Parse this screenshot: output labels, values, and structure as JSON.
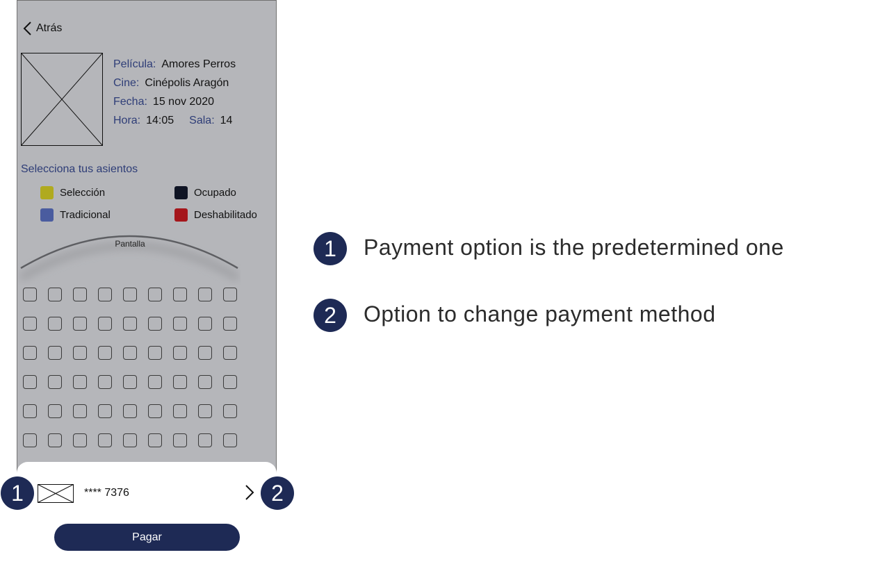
{
  "back": {
    "label": "Atrás"
  },
  "movie": {
    "pelicula_label": "Película:",
    "pelicula": "Amores Perros",
    "cine_label": "Cine:",
    "cine": "Cinépolis Aragón",
    "fecha_label": "Fecha:",
    "fecha": "15 nov 2020",
    "hora_label": "Hora:",
    "hora": "14:05",
    "sala_label": "Sala:",
    "sala": "14"
  },
  "seat_section": {
    "title": "Selecciona tus asientos",
    "legend": [
      {
        "label": "Selección",
        "color": "#b0aa1f"
      },
      {
        "label": "Ocupado",
        "color": "#0f1424"
      },
      {
        "label": "Tradicional",
        "color": "#4a5c9f"
      },
      {
        "label": "Deshabilitado",
        "color": "#a5161b"
      }
    ],
    "screen_label": "Pantalla",
    "rows": 6,
    "cols": 9
  },
  "payment": {
    "card_number": "**** 7376",
    "pay_label": "Pagar"
  },
  "annotations": [
    {
      "number": "1",
      "text": "Payment option is the predetermined one"
    },
    {
      "number": "2",
      "text": "Option to change payment method"
    }
  ],
  "colors": {
    "accent": "#1e2a55",
    "label_blue": "#2e3d77",
    "background": "#b5b6ba"
  }
}
